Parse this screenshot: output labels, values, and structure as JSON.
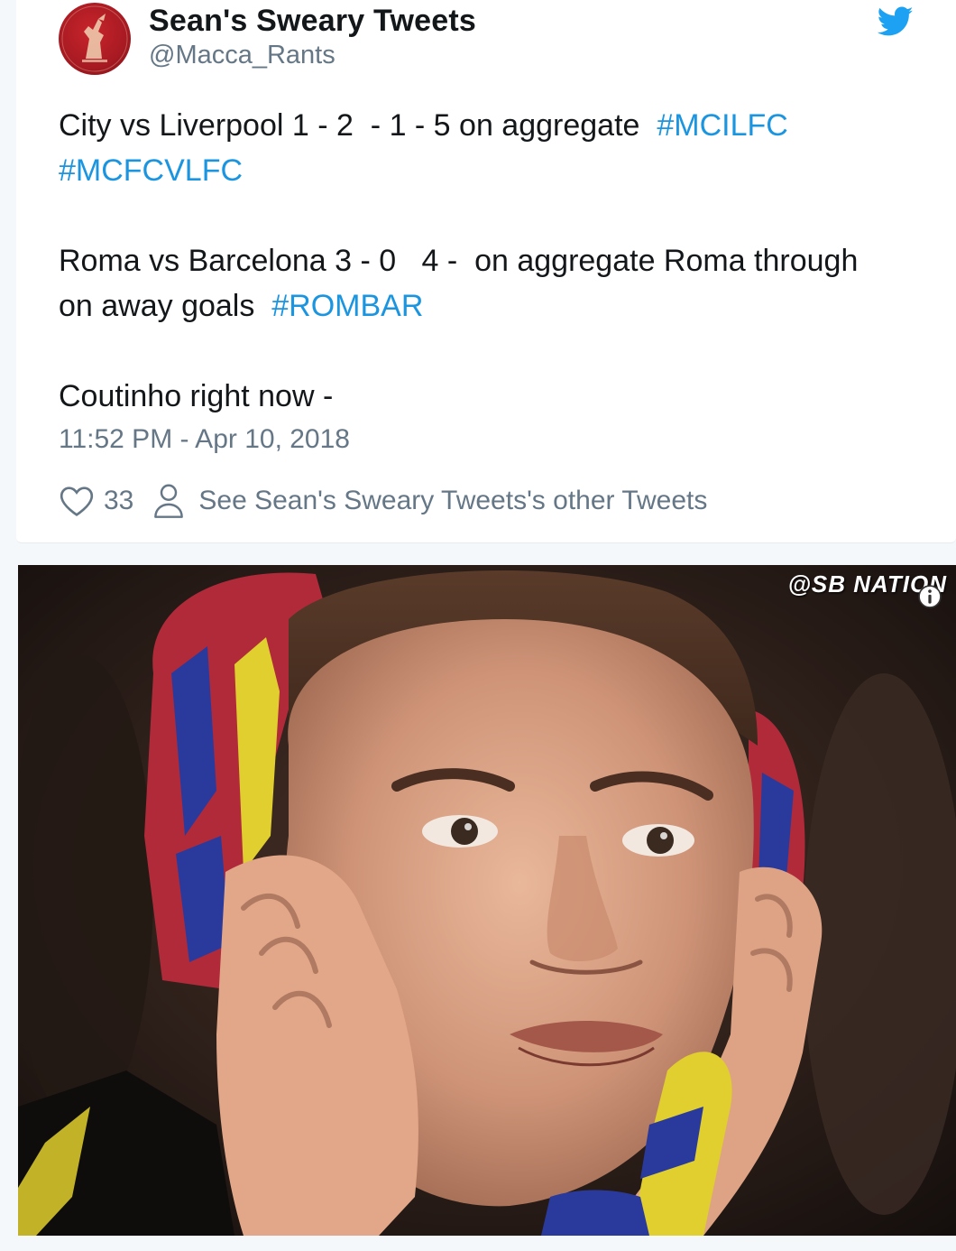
{
  "tweet": {
    "author": {
      "display_name": "Sean's Sweary Tweets",
      "handle": "@Macca_Rants",
      "avatar_icon": "liverbird-crest-icon"
    },
    "brand_icon": "twitter-bird-icon",
    "lines": [
      {
        "parts": [
          {
            "text": "City vs Liverpool 1 - 2  - 1 - 5 on aggregate  ",
            "hashtag": false
          },
          {
            "text": "#MCILFC",
            "hashtag": true
          }
        ]
      },
      {
        "parts": [
          {
            "text": "#MCFCVLFC",
            "hashtag": true
          }
        ]
      },
      {
        "gap": true
      },
      {
        "parts": [
          {
            "text": "Roma vs Barcelona 3 - 0   4 -  on aggregate Roma through",
            "hashtag": false
          }
        ]
      },
      {
        "parts": [
          {
            "text": "on away goals  ",
            "hashtag": false
          },
          {
            "text": "#ROMBAR",
            "hashtag": true
          }
        ]
      },
      {
        "gap": true
      },
      {
        "parts": [
          {
            "text": "Coutinho right now -",
            "hashtag": false
          }
        ]
      }
    ],
    "timestamp": "11:52 PM - Apr 10, 2018",
    "like_count": "33",
    "other_tweets_link": "See Sean's Sweary Tweets's other Tweets"
  },
  "media": {
    "watermark": "@SB NATION",
    "info_icon": "info-icon"
  },
  "colors": {
    "hashtag": "#1b95e0",
    "twitter_blue": "#1da1f2",
    "secondary_text": "#657786",
    "primary_text": "#14171a"
  }
}
